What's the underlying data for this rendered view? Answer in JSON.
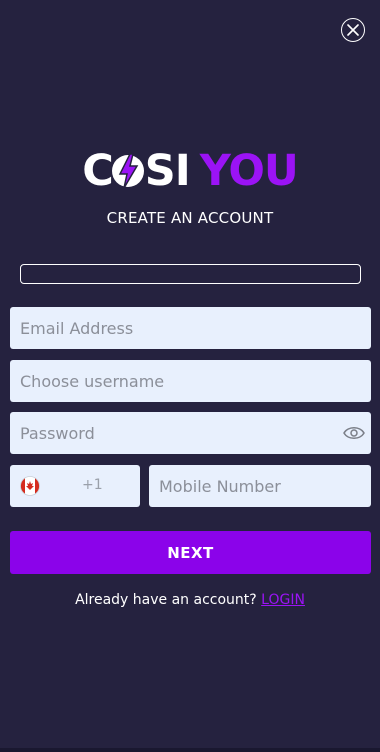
{
  "logo": {
    "part1": "C",
    "part1b": "SI",
    "part2": "YOU"
  },
  "subtitle": "CREATE AN ACCOUNT",
  "form": {
    "email_placeholder": "Email Address",
    "username_placeholder": "Choose username",
    "password_placeholder": "Password",
    "phone_code": "+1",
    "mobile_placeholder": "Mobile Number",
    "next_label": "NEXT"
  },
  "footer": {
    "prompt": "Already have an account?",
    "login_label": "LOGIN"
  },
  "colors": {
    "background": "#25223f",
    "accent": "#8b03ea",
    "input_bg": "#e8f0fd"
  },
  "icons": [
    "close-icon",
    "eye-icon",
    "canada-flag-icon",
    "bolt-icon"
  ]
}
